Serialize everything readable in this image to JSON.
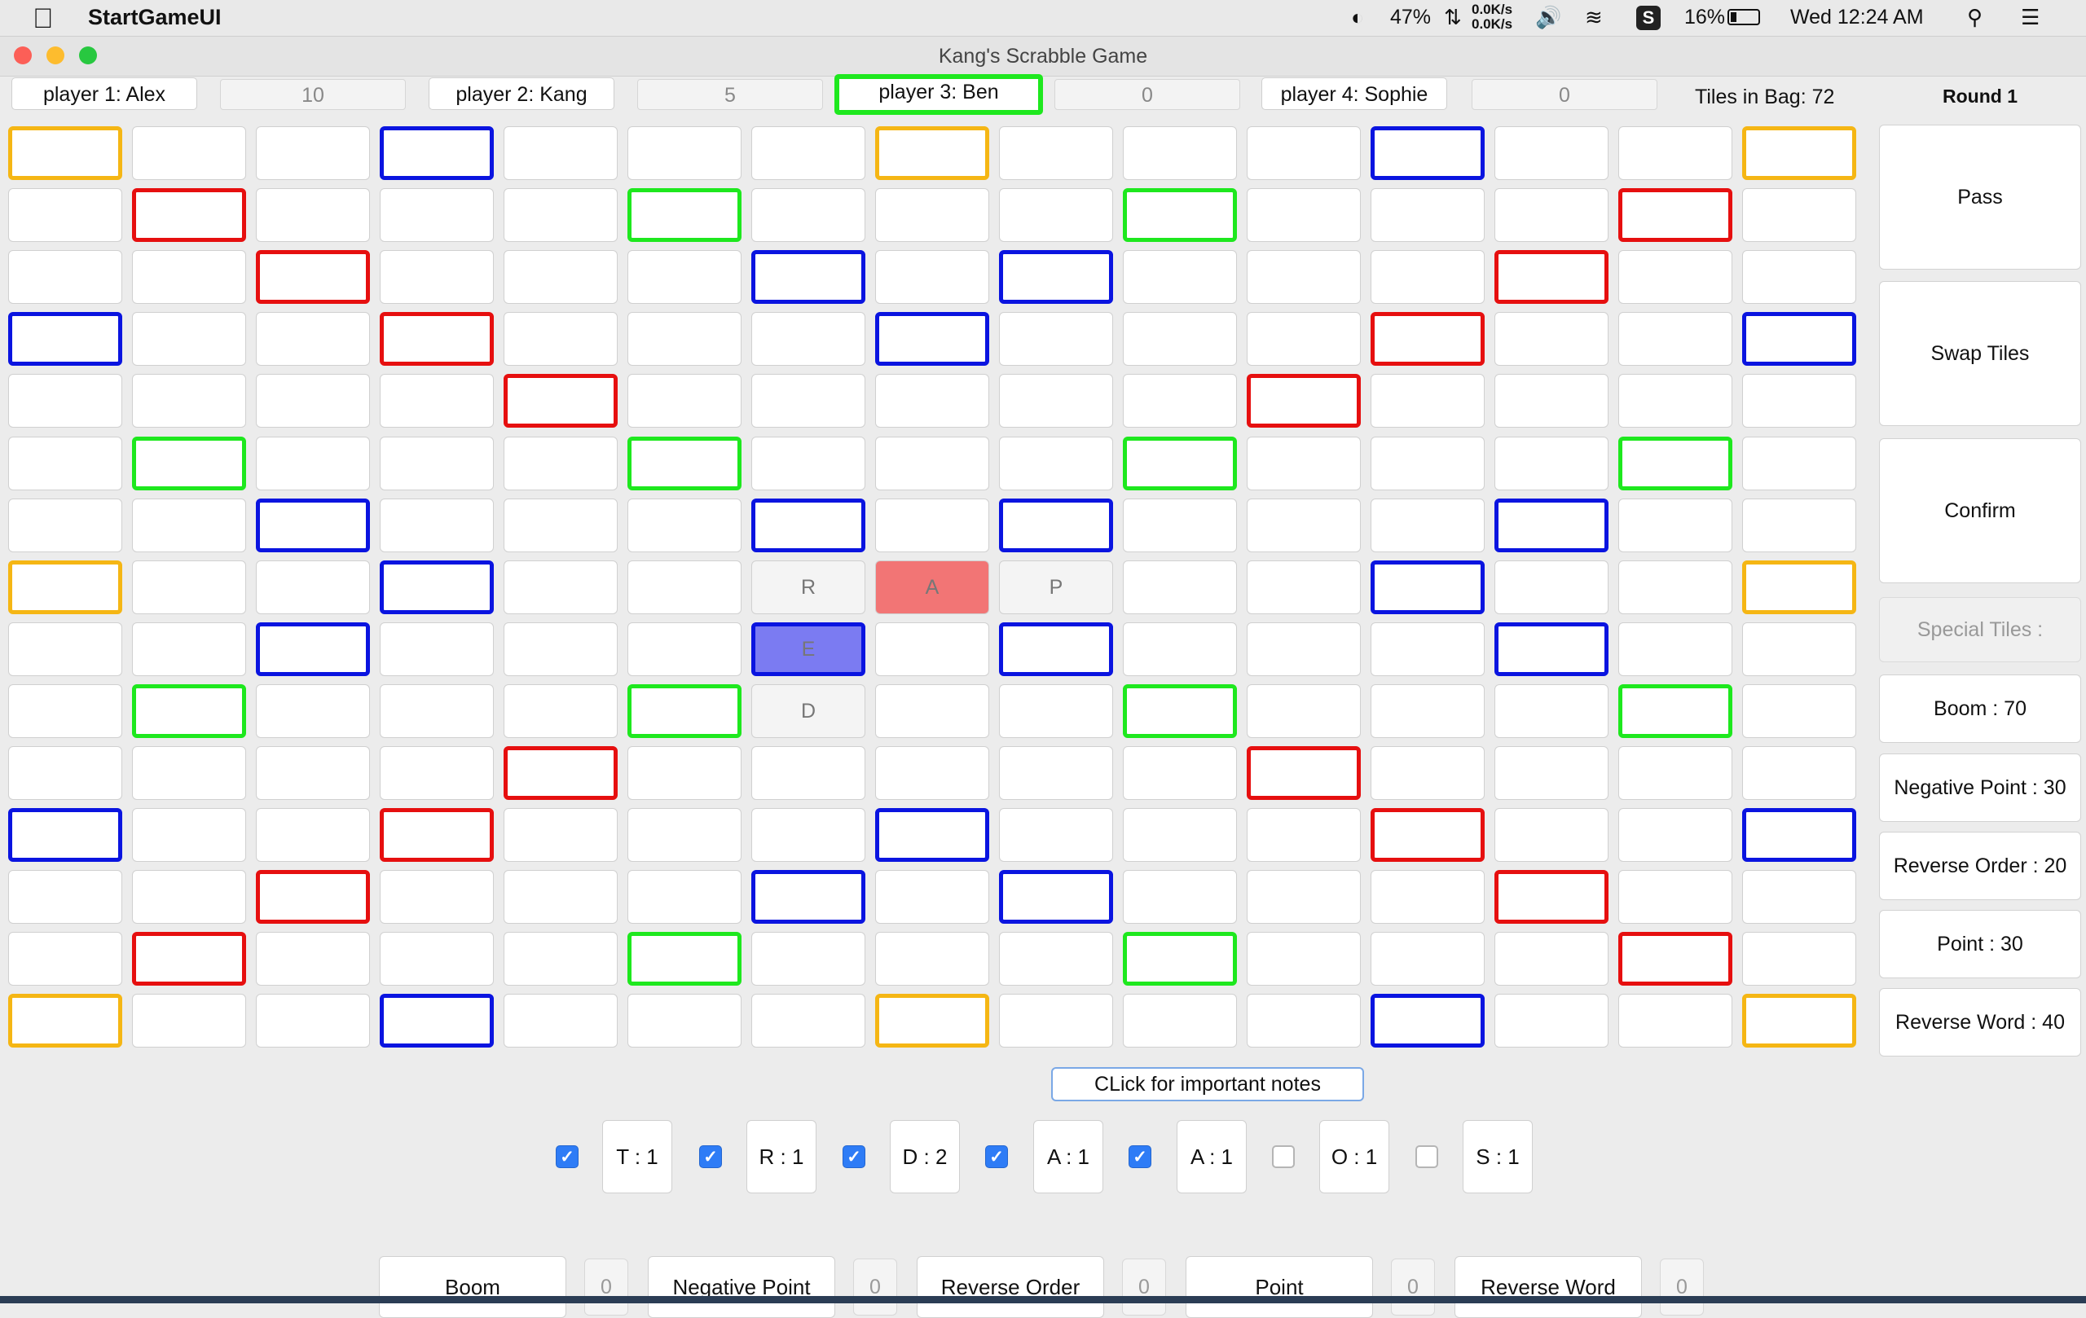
{
  "menubar": {
    "app_name": "StartGameUI",
    "battery_ring_label": "47%",
    "net_up": "0.0K/s",
    "net_down": "0.0K/s",
    "battery": "16%",
    "clock": "Wed 12:24 AM"
  },
  "window": {
    "title": "Kang's Scrabble Game"
  },
  "players": [
    {
      "label": "player 1: Alex",
      "score": "10",
      "active": false
    },
    {
      "label": "player 2: Kang",
      "score": "5",
      "active": false
    },
    {
      "label": "player 3: Ben",
      "score": "0",
      "active": true
    },
    {
      "label": "player 4: Sophie",
      "score": "0",
      "active": false
    }
  ],
  "tiles_in_bag": "Tiles in Bag: 72",
  "round": "Round 1",
  "board": {
    "size": 15,
    "premium_colors": {
      "yellow": "#f5b614",
      "blue": "#0a14e0",
      "red": "#e60f0f",
      "green": "#1ee81e"
    },
    "rows": [
      "Y..B...Y...B..Y",
      ".R...G...G...R.",
      "..R...B.B...R..",
      "B..R...B...R..B",
      "....R.....R....",
      ".G...G...G...G.",
      "..B...B.B...B..",
      "Y..B.......B..Y",
      "..B...B.B...B..",
      ".G...G...G...G.",
      "....R.....R....",
      "B..R...B...R..B",
      "..R...B.B...R..",
      ".R...G...G...R.",
      "Y..B...Y...B..Y"
    ],
    "placed_tiles": [
      {
        "row": 7,
        "col": 6,
        "letter": "R",
        "fill": "plain"
      },
      {
        "row": 7,
        "col": 7,
        "letter": "A",
        "fill": "red"
      },
      {
        "row": 7,
        "col": 8,
        "letter": "P",
        "fill": "plain"
      },
      {
        "row": 8,
        "col": 6,
        "letter": "E",
        "fill": "blue"
      },
      {
        "row": 9,
        "col": 6,
        "letter": "D",
        "fill": "plain"
      }
    ]
  },
  "sidebar": {
    "pass": "Pass",
    "swap": "Swap Tiles",
    "confirm": "Confirm",
    "special_header": "Special Tiles :",
    "special_costs": [
      "Boom : 70",
      "Negative Point : 30",
      "Reverse Order : 20",
      "Point : 30",
      "Reverse Word : 40"
    ]
  },
  "notes_button": "CLick for important notes",
  "rack": [
    {
      "label": "T : 1",
      "checked": true
    },
    {
      "label": "R : 1",
      "checked": true
    },
    {
      "label": "D : 2",
      "checked": true
    },
    {
      "label": "A : 1",
      "checked": true
    },
    {
      "label": "A : 1",
      "checked": true
    },
    {
      "label": "O : 1",
      "checked": false
    },
    {
      "label": "S : 1",
      "checked": false
    }
  ],
  "special_tiles_owned": [
    {
      "name": "Boom",
      "count": "0"
    },
    {
      "name": "Negative Point",
      "count": "0"
    },
    {
      "name": "Reverse Order",
      "count": "0"
    },
    {
      "name": "Point",
      "count": "0"
    },
    {
      "name": "Reverse Word",
      "count": "0"
    }
  ],
  "check_glyph": "✓"
}
